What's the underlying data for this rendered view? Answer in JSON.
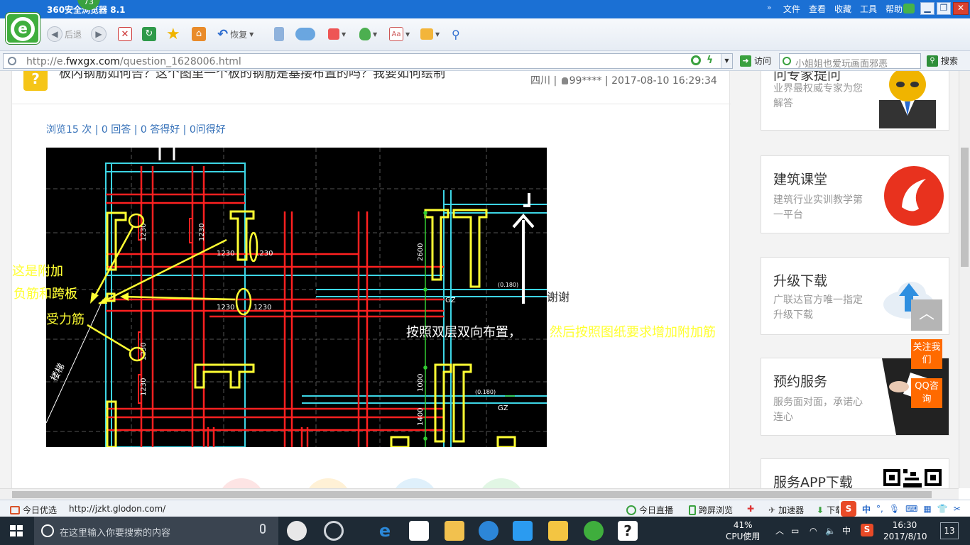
{
  "browser": {
    "title": "360安全浏览器 8.1",
    "badge": "73",
    "menus": [
      "文件",
      "查看",
      "收藏",
      "工具",
      "帮助"
    ],
    "toolbar": {
      "back": "后退",
      "restore": "恢复"
    },
    "address": {
      "prefix": "http://e.",
      "domain": "fwxgx.com",
      "path": "/question_1628006.html"
    },
    "visit": "访问",
    "search_placeholder": "小姐姐也爱玩画面邪恶",
    "search_btn": "搜索"
  },
  "question": {
    "title": "板内钢筋如何告？这个图里一个板的钢筋是基接布置的吗？我要如何绘制",
    "meta_region": "四川",
    "meta_user": "99****",
    "meta_time": "2017-08-10 16:29:34",
    "stats": "浏览15 次 | 0 回答 | 0 答得好 | 0问得好",
    "annotations": {
      "a1": "这是附加",
      "a2": "负筋和跨板",
      "a3": "受力筋",
      "a4_white": "按照双层双向布置，",
      "a4_yellow": "然后按照图纸要求增加附加筋"
    },
    "thanks": "谢谢",
    "cad_labels": {
      "n1230": "1230",
      "n2600": "2600",
      "n1000": "1000",
      "n1400": "1400",
      "gz": "GZ",
      "lvl": "(0.180)",
      "stair": "楼梯"
    }
  },
  "sidebar": [
    {
      "title": "问专家提问",
      "desc": "业界最权威专家为您解答"
    },
    {
      "title": "建筑课堂",
      "desc": "建筑行业实训教学第一平台"
    },
    {
      "title": "升级下载",
      "desc": "广联达官方唯一指定升级下载"
    },
    {
      "title": "预约服务",
      "desc": "服务面对面，承诺心连心"
    },
    {
      "title": "服务APP下载",
      "desc": ""
    }
  ],
  "float": {
    "follow": "关注我们",
    "qq": "QQ咨询"
  },
  "statusbar": {
    "today": "今日优选",
    "url": "http://jzkt.glodon.com/",
    "live": "今日直播",
    "screen": "跨屏浏览",
    "accel": "加速器",
    "download": "下载"
  },
  "taskbar": {
    "search_placeholder": "在这里输入你要搜索的内容",
    "cpu_pct": "41%",
    "cpu_label": "CPU使用",
    "ime": "中",
    "time": "16:30",
    "date": "2017/8/10",
    "notif": "13"
  },
  "colors": {
    "brand_green": "#3fae3d",
    "title_blue": "#1b70d4",
    "link_blue": "#3470b8",
    "accent_orange": "#ff6a00"
  }
}
